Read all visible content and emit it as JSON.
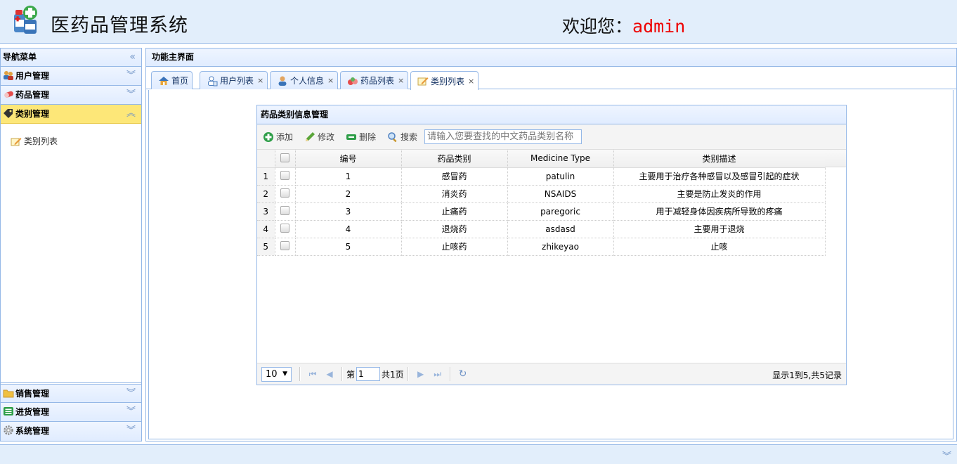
{
  "header": {
    "title": "医药品管理系统",
    "welcome_prefix": "欢迎您：",
    "username": "admin"
  },
  "nav": {
    "title": "导航菜单",
    "sections": [
      {
        "label": "用户管理",
        "icon": "users-icon"
      },
      {
        "label": "药品管理",
        "icon": "pill-icon"
      },
      {
        "label": "类别管理",
        "icon": "tag-icon",
        "selected": true
      }
    ],
    "tree_items": [
      {
        "label": "类别列表",
        "icon": "pencil-note-icon"
      }
    ],
    "bottom_sections": [
      {
        "label": "销售管理",
        "icon": "folder-icon"
      },
      {
        "label": "进货管理",
        "icon": "list-icon"
      },
      {
        "label": "系统管理",
        "icon": "gear-icon"
      }
    ]
  },
  "center": {
    "title": "功能主界面",
    "tabs": [
      {
        "label": "首页",
        "icon": "home-icon",
        "closable": false
      },
      {
        "label": "用户列表",
        "icon": "user-list-icon",
        "closable": true
      },
      {
        "label": "个人信息",
        "icon": "person-icon",
        "closable": true
      },
      {
        "label": "药品列表",
        "icon": "pill-icon",
        "closable": true
      },
      {
        "label": "类别列表",
        "icon": "pencil-note-icon",
        "closable": true,
        "active": true
      }
    ],
    "close_glyph": "×"
  },
  "grid": {
    "title": "药品类别信息管理",
    "toolbar": {
      "add": "添加",
      "edit": "修改",
      "delete": "删除",
      "search": "搜索",
      "search_placeholder": "请输入您要查找的中文药品类别名称"
    },
    "columns": [
      "编号",
      "药品类别",
      "Medicine Type",
      "类别描述"
    ],
    "rows": [
      {
        "rn": "1",
        "id": "1",
        "name": "感冒药",
        "type": "patulin",
        "desc": "主要用于治疗各种感冒以及感冒引起的症状"
      },
      {
        "rn": "2",
        "id": "2",
        "name": "消炎药",
        "type": "NSAIDS",
        "desc": "主要是防止发炎的作用"
      },
      {
        "rn": "3",
        "id": "3",
        "name": "止痛药",
        "type": "paregoric",
        "desc": "用于减轻身体因疾病所导致的疼痛"
      },
      {
        "rn": "4",
        "id": "4",
        "name": "退烧药",
        "type": "asdasd",
        "desc": "主要用于退烧"
      },
      {
        "rn": "5",
        "id": "5",
        "name": "止咳药",
        "type": "zhikeyao",
        "desc": "止咳"
      }
    ],
    "pager": {
      "page_size": "10",
      "page_prefix": "第",
      "page_value": "1",
      "page_suffix": "共1页",
      "info": "显示1到5,共5记录"
    }
  }
}
